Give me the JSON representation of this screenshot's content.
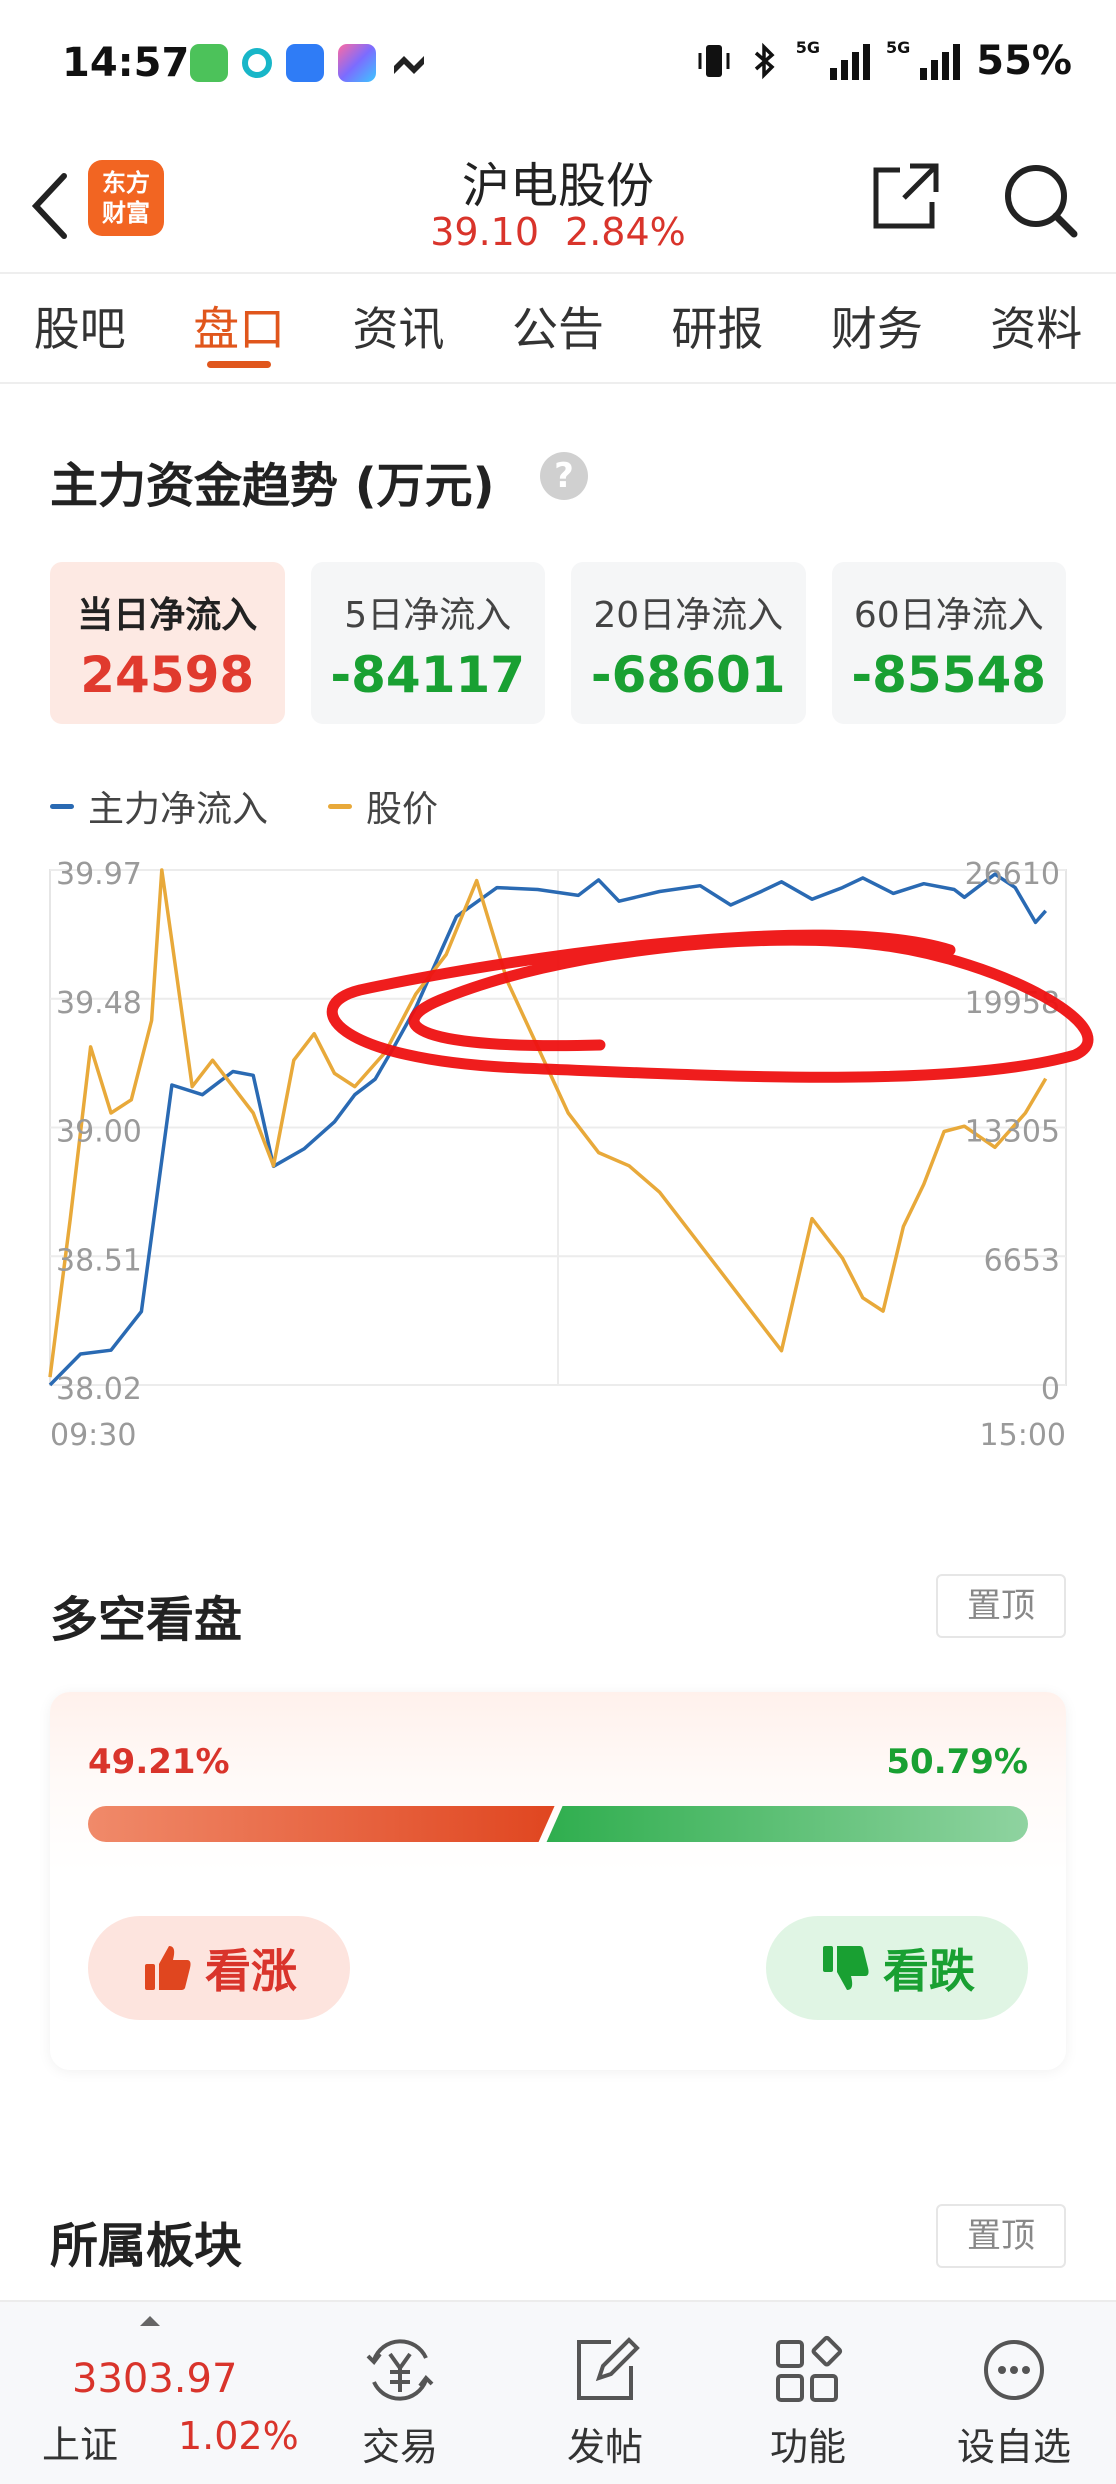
{
  "status_bar": {
    "time": "14:57",
    "signal_label_1": "5G",
    "signal_label_2": "5G",
    "battery": "55%"
  },
  "header": {
    "logo_line1": "东方",
    "logo_line2": "财富",
    "stock_name": "沪电股份",
    "price": "39.10",
    "change_pct": "2.84%"
  },
  "tabs": [
    {
      "label": "股吧",
      "active": false
    },
    {
      "label": "盘口",
      "active": true
    },
    {
      "label": "资讯",
      "active": false
    },
    {
      "label": "公告",
      "active": false
    },
    {
      "label": "研报",
      "active": false
    },
    {
      "label": "财务",
      "active": false
    },
    {
      "label": "资料",
      "active": false
    }
  ],
  "fund_flow": {
    "title": "主力资金趋势 (万元)",
    "help": "?",
    "cards": [
      {
        "label": "当日净流入",
        "value": "24598",
        "trend": "up",
        "active": true
      },
      {
        "label": "5日净流入",
        "value": "-84117",
        "trend": "down",
        "active": false
      },
      {
        "label": "20日净流入",
        "value": "-68601",
        "trend": "down",
        "active": false
      },
      {
        "label": "60日净流入",
        "value": "-85548",
        "trend": "down",
        "active": false
      }
    ],
    "legend": [
      {
        "name": "主力净流入",
        "color": "#2a6ab3"
      },
      {
        "name": "股价",
        "color": "#e8a93a"
      }
    ]
  },
  "chart_data": {
    "type": "line",
    "x_start_label": "09:30",
    "x_end_label": "15:00",
    "y_left_ticks": [
      "39.97",
      "39.48",
      "39.00",
      "38.51",
      "38.02"
    ],
    "y_right_ticks": [
      "26610",
      "19958",
      "13305",
      "6653",
      "0"
    ],
    "y_left_range": [
      38.02,
      39.97
    ],
    "y_right_range": [
      0,
      26610
    ],
    "grid": true,
    "series": [
      {
        "name": "主力净流入",
        "axis": "right",
        "color": "#2a6ab3",
        "x": [
          0,
          0.03,
          0.06,
          0.09,
          0.12,
          0.15,
          0.18,
          0.2,
          0.22,
          0.25,
          0.28,
          0.3,
          0.32,
          0.34,
          0.36,
          0.4,
          0.44,
          0.48,
          0.52,
          0.54,
          0.56,
          0.6,
          0.64,
          0.67,
          0.7,
          0.72,
          0.75,
          0.78,
          0.8,
          0.83,
          0.86,
          0.89,
          0.9,
          0.93,
          0.95,
          0.97,
          0.98
        ],
        "values": [
          0,
          1600,
          1800,
          3800,
          15500,
          15000,
          16200,
          16000,
          11300,
          12200,
          13600,
          15000,
          15800,
          17600,
          19500,
          24200,
          25700,
          25600,
          25300,
          26100,
          25000,
          25500,
          25800,
          24800,
          25500,
          26000,
          25100,
          25700,
          26200,
          25400,
          25900,
          25600,
          25200,
          26400,
          25700,
          23900,
          24500
        ]
      },
      {
        "name": "股价",
        "axis": "left",
        "color": "#e8a93a",
        "x": [
          0,
          0.02,
          0.04,
          0.06,
          0.08,
          0.1,
          0.11,
          0.12,
          0.14,
          0.16,
          0.18,
          0.2,
          0.22,
          0.24,
          0.26,
          0.28,
          0.3,
          0.33,
          0.36,
          0.39,
          0.42,
          0.45,
          0.48,
          0.51,
          0.54,
          0.57,
          0.6,
          0.63,
          0.66,
          0.69,
          0.72,
          0.75,
          0.78,
          0.8,
          0.82,
          0.84,
          0.86,
          0.88,
          0.9,
          0.93,
          0.96,
          0.98
        ],
        "values": [
          38.05,
          38.65,
          39.3,
          39.05,
          39.1,
          39.4,
          39.97,
          39.7,
          39.15,
          39.25,
          39.15,
          39.05,
          38.85,
          39.25,
          39.35,
          39.2,
          39.15,
          39.28,
          39.5,
          39.65,
          39.93,
          39.55,
          39.3,
          39.05,
          38.9,
          38.85,
          38.75,
          38.6,
          38.45,
          38.3,
          38.15,
          38.65,
          38.5,
          38.35,
          38.3,
          38.62,
          38.78,
          38.98,
          39.0,
          38.92,
          39.05,
          39.18
        ]
      }
    ]
  },
  "long_short": {
    "title": "多空看盘",
    "pin_label": "置顶",
    "bull_pct": "49.21%",
    "bear_pct": "50.79%",
    "bull_ratio": 0.4921,
    "bull_label": "看涨",
    "bear_label": "看跌"
  },
  "sector": {
    "title": "所属板块",
    "pin_label": "置顶"
  },
  "bottom_bar": {
    "index_value": "3303.97",
    "index_name": "上证",
    "index_change": "1.02%",
    "nav": [
      {
        "label": "交易",
        "icon": "trade-icon"
      },
      {
        "label": "发帖",
        "icon": "compose-icon"
      },
      {
        "label": "功能",
        "icon": "apps-grid-icon"
      },
      {
        "label": "设自选",
        "icon": "add-watchlist-icon"
      }
    ]
  }
}
